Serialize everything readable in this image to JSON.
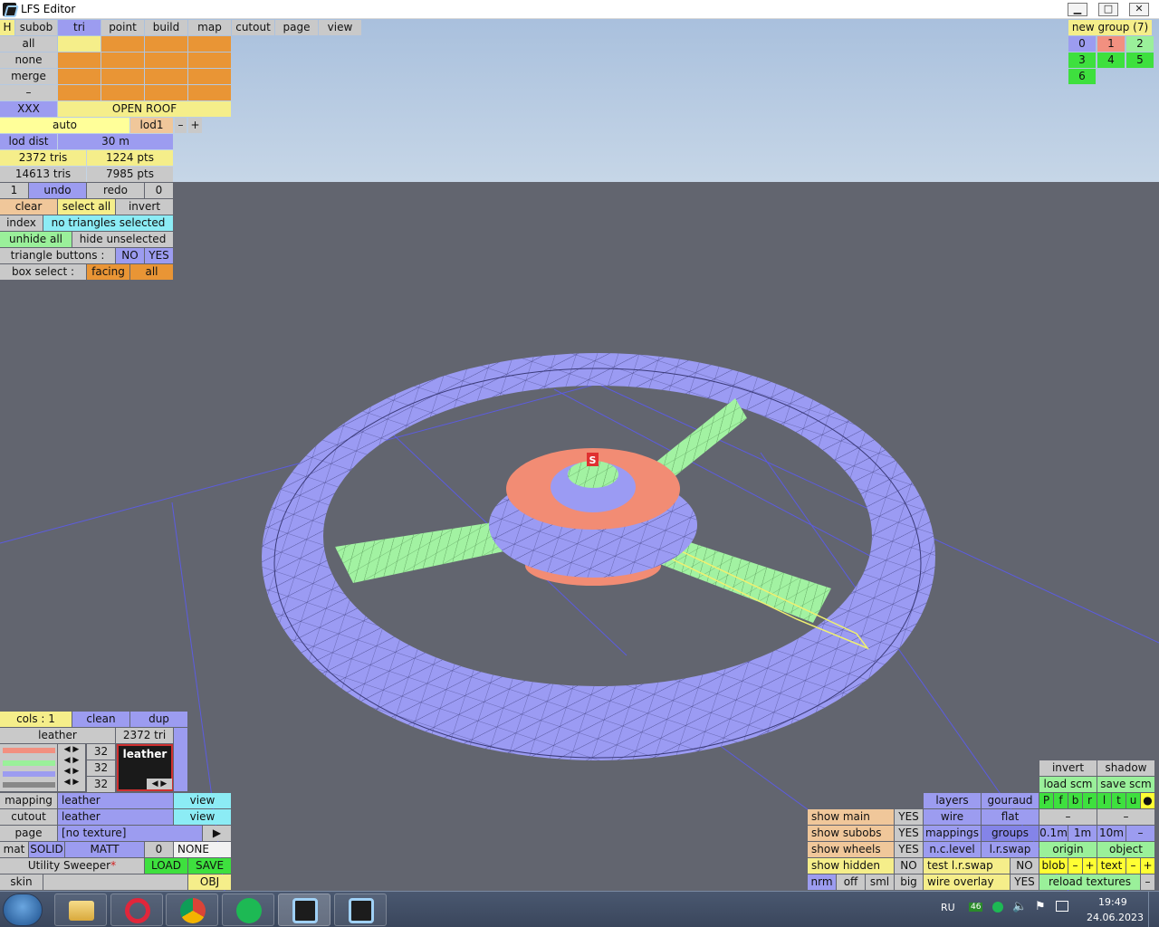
{
  "window": {
    "title": "LFS Editor",
    "min": "▁",
    "max": "□",
    "close": "✕"
  },
  "top_tabs": [
    "H",
    "subob",
    "tri",
    "point",
    "build",
    "map",
    "cutout",
    "page",
    "view"
  ],
  "side_rows": [
    "all",
    "none",
    "merge",
    "–"
  ],
  "xxx": "XXX",
  "open_roof": "OPEN ROOF",
  "auto": "auto",
  "lod": "lod1",
  "minus": "–",
  "plus": "+",
  "lod_dist": "lod dist",
  "lod_dist_val": "30 m",
  "tris": "2372 tris",
  "pts": "1224 pts",
  "total_tris": "14613 tris",
  "total_pts": "7985 pts",
  "undo_count": "1",
  "undo": "undo",
  "redo": "redo",
  "redo_count": "0",
  "clear": "clear",
  "select_all": "select all",
  "invert": "invert",
  "index": "index",
  "no_sel": "no triangles selected",
  "unhide_all": "unhide all",
  "hide_unselected": "hide unselected",
  "tri_buttons": "triangle buttons :",
  "no": "NO",
  "yes": "YES",
  "box_select": "box select :",
  "facing": "facing",
  "all": "all",
  "groups_panel": {
    "title": "new group (7)",
    "items": [
      "0",
      "1",
      "2",
      "3",
      "4",
      "5",
      "6"
    ]
  },
  "cols": "cols : 1",
  "clean": "clean",
  "dup": "dup",
  "mat_name": "leather",
  "mat_tris": "2372 tri",
  "col_vals": [
    "32",
    "32",
    "32"
  ],
  "preview_label": "leather",
  "mapping": "mapping",
  "cutout": "cutout",
  "page": "page",
  "view": "view",
  "no_texture": "[no texture]",
  "play": "▶",
  "mat": "mat",
  "solid": "SOLID",
  "matt": "MATT",
  "zero": "0",
  "none": "NONE",
  "utility": "Utility Sweeper",
  "star": "*",
  "load": "LOAD",
  "save": "SAVE",
  "skin": "skin",
  "obj": "OBJ",
  "br": {
    "invert": "invert",
    "shadow": "shadow",
    "load_scm": "load scm",
    "save_scm": "save scm",
    "pf": [
      "P",
      "f",
      "b",
      "r",
      "l",
      "t",
      "u",
      "●"
    ],
    "dash": "–",
    "layers": "layers",
    "gouraud": "gouraud",
    "wire": "wire",
    "flat": "flat",
    "show_main": "show main",
    "show_subobs": "show subobs",
    "show_wheels": "show wheels",
    "show_hidden": "show hidden",
    "mappings": "mappings",
    "groups": "groups",
    "ncl": "n.c.level",
    "lrswap": "l.r.swap",
    "test_lr": "test l.r.swap",
    "wire_overlay": "wire overlay",
    "m01": "0.1m",
    "m1": "1m",
    "m10": "10m",
    "origin": "origin",
    "object": "object",
    "blob": "blob",
    "text": "text",
    "reload": "reload textures",
    "nrm": "nrm",
    "off": "off",
    "sml": "sml",
    "big": "big"
  },
  "pivot": "S",
  "taskbar": {
    "lang": "RU",
    "badge": "46",
    "time": "19:49",
    "date": "24.06.2023"
  }
}
